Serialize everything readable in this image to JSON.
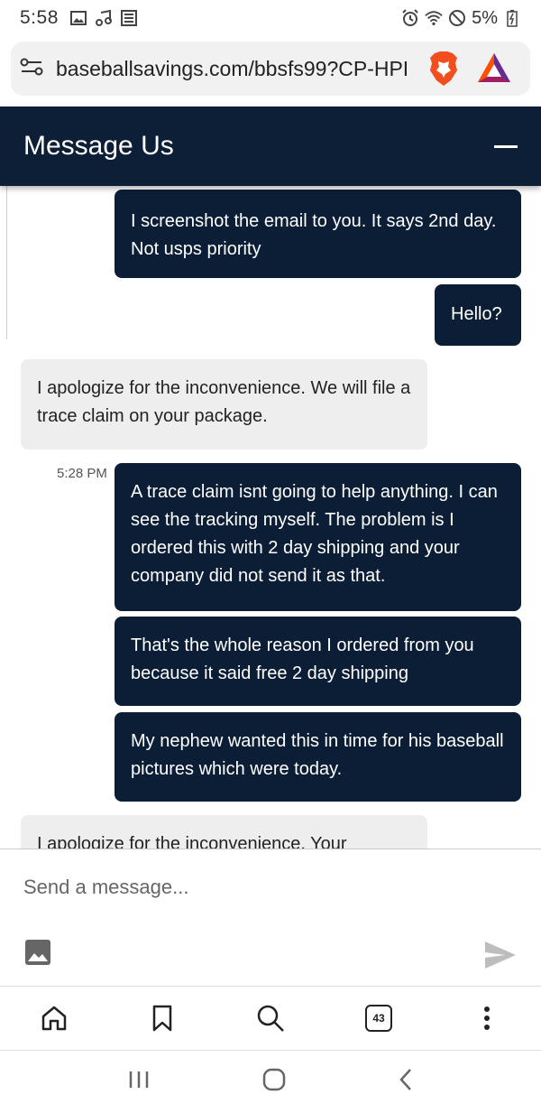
{
  "status_bar": {
    "time": "5:58",
    "battery": "5%"
  },
  "browser": {
    "url": "baseballsavings.com/bbsfs99?CP-HPI",
    "tab_count": "43"
  },
  "chat": {
    "title": "Message Us",
    "messages": [
      {
        "from": "user",
        "text": "I screenshot the email to you. It says 2nd day. Not usps priority"
      },
      {
        "from": "user",
        "text": "Hello?"
      },
      {
        "from": "agent",
        "text": "I apologize for the inconvenience. We will file a trace claim on your package."
      },
      {
        "from": "user",
        "time": "5:28 PM",
        "text": "A trace claim isnt going to help anything. I can see the tracking myself. The problem is I ordered this with 2 day shipping and your company did not send it as that."
      },
      {
        "from": "user",
        "text": "That's the whole reason I ordered from you because it said free 2 day shipping"
      },
      {
        "from": "user",
        "text": "My nephew wanted this in time for his baseball pictures which were today."
      },
      {
        "from": "agent",
        "text": "I apologize for the inconvenience. Your"
      }
    ],
    "composer_placeholder": "Send a message..."
  }
}
